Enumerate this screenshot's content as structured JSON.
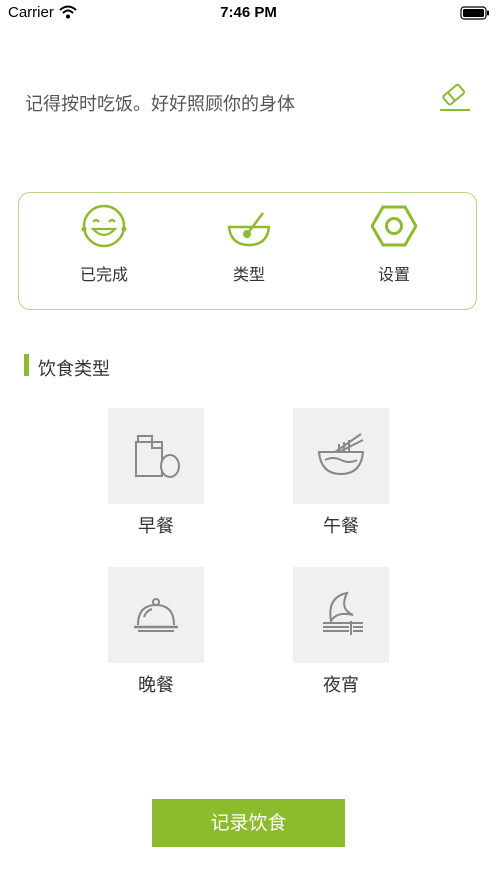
{
  "status": {
    "carrier": "Carrier",
    "time": "7:46 PM"
  },
  "intro": {
    "text": "记得按时吃饭。好好照顾你的身体"
  },
  "features": [
    {
      "label": "已完成",
      "icon": "smiley-face-icon"
    },
    {
      "label": "类型",
      "icon": "bowl-spoon-icon"
    },
    {
      "label": "设置",
      "icon": "hex-nut-icon"
    }
  ],
  "section": {
    "title": "饮食类型"
  },
  "meals": [
    {
      "label": "早餐",
      "icon": "bottle-egg-icon"
    },
    {
      "label": "午餐",
      "icon": "noodle-bowl-icon"
    },
    {
      "label": "晚餐",
      "icon": "cloche-icon"
    },
    {
      "label": "夜宵",
      "icon": "moon-fork-icon"
    }
  ],
  "actions": {
    "record": "记录饮食"
  },
  "colors": {
    "accent": "#8dbb2e",
    "tile_bg": "#f0f0f0",
    "border": "#b7d68a"
  }
}
